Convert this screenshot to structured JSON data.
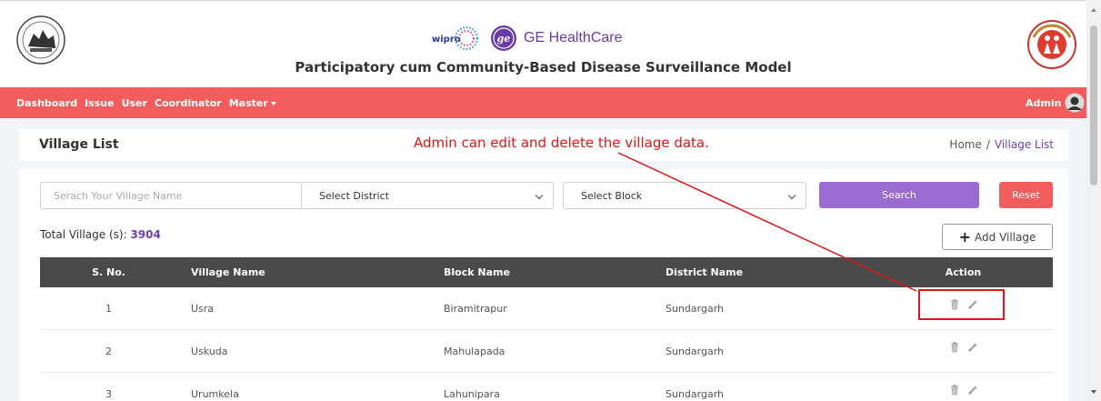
{
  "header": {
    "brand_wipro": "wipro",
    "brand_ge": "GE HealthCare",
    "title": "Participatory cum Community-Based Disease Surveillance Model",
    "logo_left": "odisha-govt-emblem",
    "logo_right": "national-health-mission-logo"
  },
  "nav": {
    "items": [
      "Dashboard",
      "Issue",
      "User",
      "Coordinator",
      "Master"
    ],
    "user_label": "Admin"
  },
  "page": {
    "title": "Village List",
    "annotation": "Admin can edit and delete the village data.",
    "breadcrumb": {
      "home": "Home",
      "separator": "/",
      "current": "Village List"
    }
  },
  "filters": {
    "search_placeholder": "Serach Your Village Name",
    "district": "Select District",
    "block": "Select Block",
    "search_button": "Search",
    "reset_button": "Reset"
  },
  "summary": {
    "total_label": "Total Village (s):",
    "total_value": "3904",
    "add_button": "Add Village"
  },
  "table": {
    "columns": [
      "S. No.",
      "Village Name",
      "Block Name",
      "District Name",
      "Action"
    ],
    "rows": [
      {
        "sno": "1",
        "village": "Usra",
        "block": "Biramitrapur",
        "district": "Sundargarh"
      },
      {
        "sno": "2",
        "village": "Uskuda",
        "block": "Mahulapada",
        "district": "Sundargarh"
      },
      {
        "sno": "3",
        "village": "Urumkela",
        "block": "Lahunipara",
        "district": "Sundargarh"
      }
    ]
  },
  "colors": {
    "nav": "#f25c5c",
    "accent_purple": "#9a6bd0",
    "annotation_red": "#e11515",
    "table_header": "#4a4a4a"
  }
}
